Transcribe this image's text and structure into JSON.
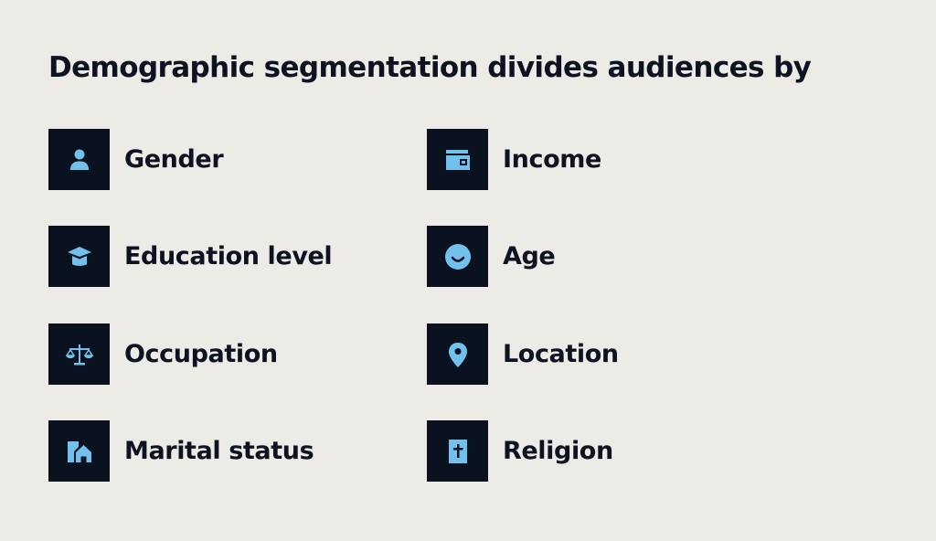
{
  "title": "Demographic segmentation divides audiences by",
  "icon_color": "#72c1ec",
  "tile_color": "#0a1220",
  "background_color": "#ecebe5",
  "items": [
    {
      "label": "Gender",
      "icon": "person-icon"
    },
    {
      "label": "Income",
      "icon": "wallet-icon"
    },
    {
      "label": "Education level",
      "icon": "graduation-cap-icon"
    },
    {
      "label": "Age",
      "icon": "smiley-face-icon"
    },
    {
      "label": "Occupation",
      "icon": "scales-icon"
    },
    {
      "label": "Location",
      "icon": "map-pin-icon"
    },
    {
      "label": "Marital status",
      "icon": "house-icon"
    },
    {
      "label": "Religion",
      "icon": "cross-book-icon"
    }
  ]
}
